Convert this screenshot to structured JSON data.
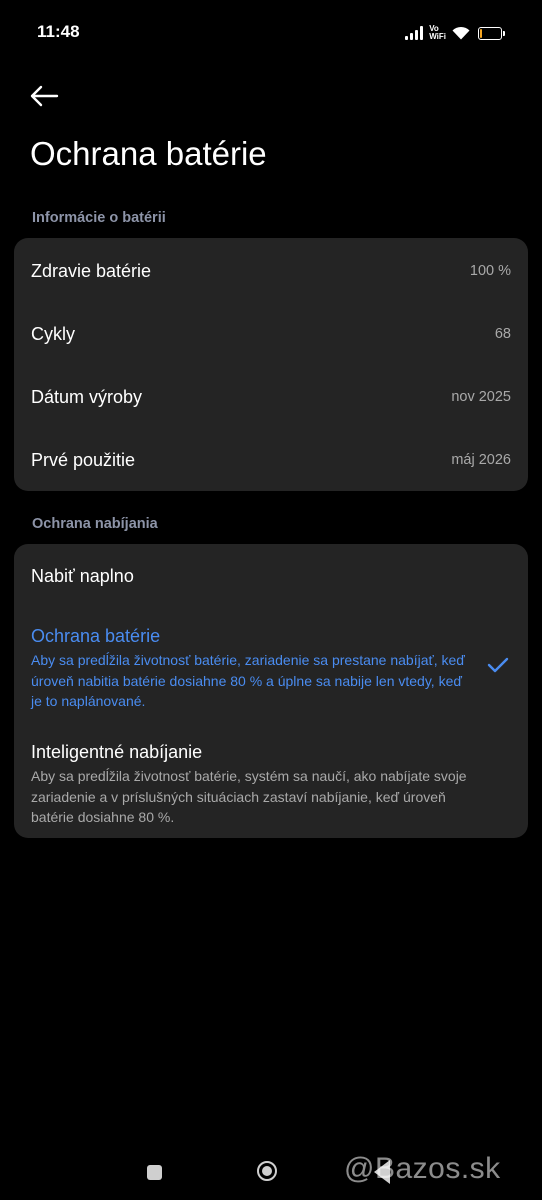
{
  "status_bar": {
    "time": "11:48",
    "vowifi_top": "Vo",
    "vowifi_bottom": "WiFi",
    "battery_level": 0.12,
    "battery_color": "#f5a623"
  },
  "header": {
    "back_icon": "arrow-left-icon",
    "title": "Ochrana batérie"
  },
  "battery_info": {
    "section_title": "Informácie o batérii",
    "rows": [
      {
        "label": "Zdravie batérie",
        "value": "100 %"
      },
      {
        "label": "Cykly",
        "value": "68"
      },
      {
        "label": "Dátum výroby",
        "value": "nov 2025"
      },
      {
        "label": "Prvé použitie",
        "value": "máj 2026"
      }
    ]
  },
  "charging_protection": {
    "section_title": "Ochrana nabíjania",
    "options": [
      {
        "title": "Nabiť naplno",
        "description": "",
        "selected": false
      },
      {
        "title": "Ochrana batérie",
        "description": "Aby sa predĺžila životnosť batérie, zariadenie sa prestane nabíjať, keď úroveň nabitia batérie dosiahne 80 % a úplne sa nabije len vtedy, keď je to naplánované.",
        "selected": true
      },
      {
        "title": "Inteligentné nabíjanie",
        "description": "Aby sa predĺžila životnosť batérie, systém sa naučí, ako nabíjate svoje zariadenie a v príslušných situáciach zastaví nabíjanie, keď úroveň batérie dosiahne 80 %.",
        "selected": false
      }
    ],
    "accent_color": "#4a8cf0"
  },
  "watermark": "@Bazos.sk"
}
